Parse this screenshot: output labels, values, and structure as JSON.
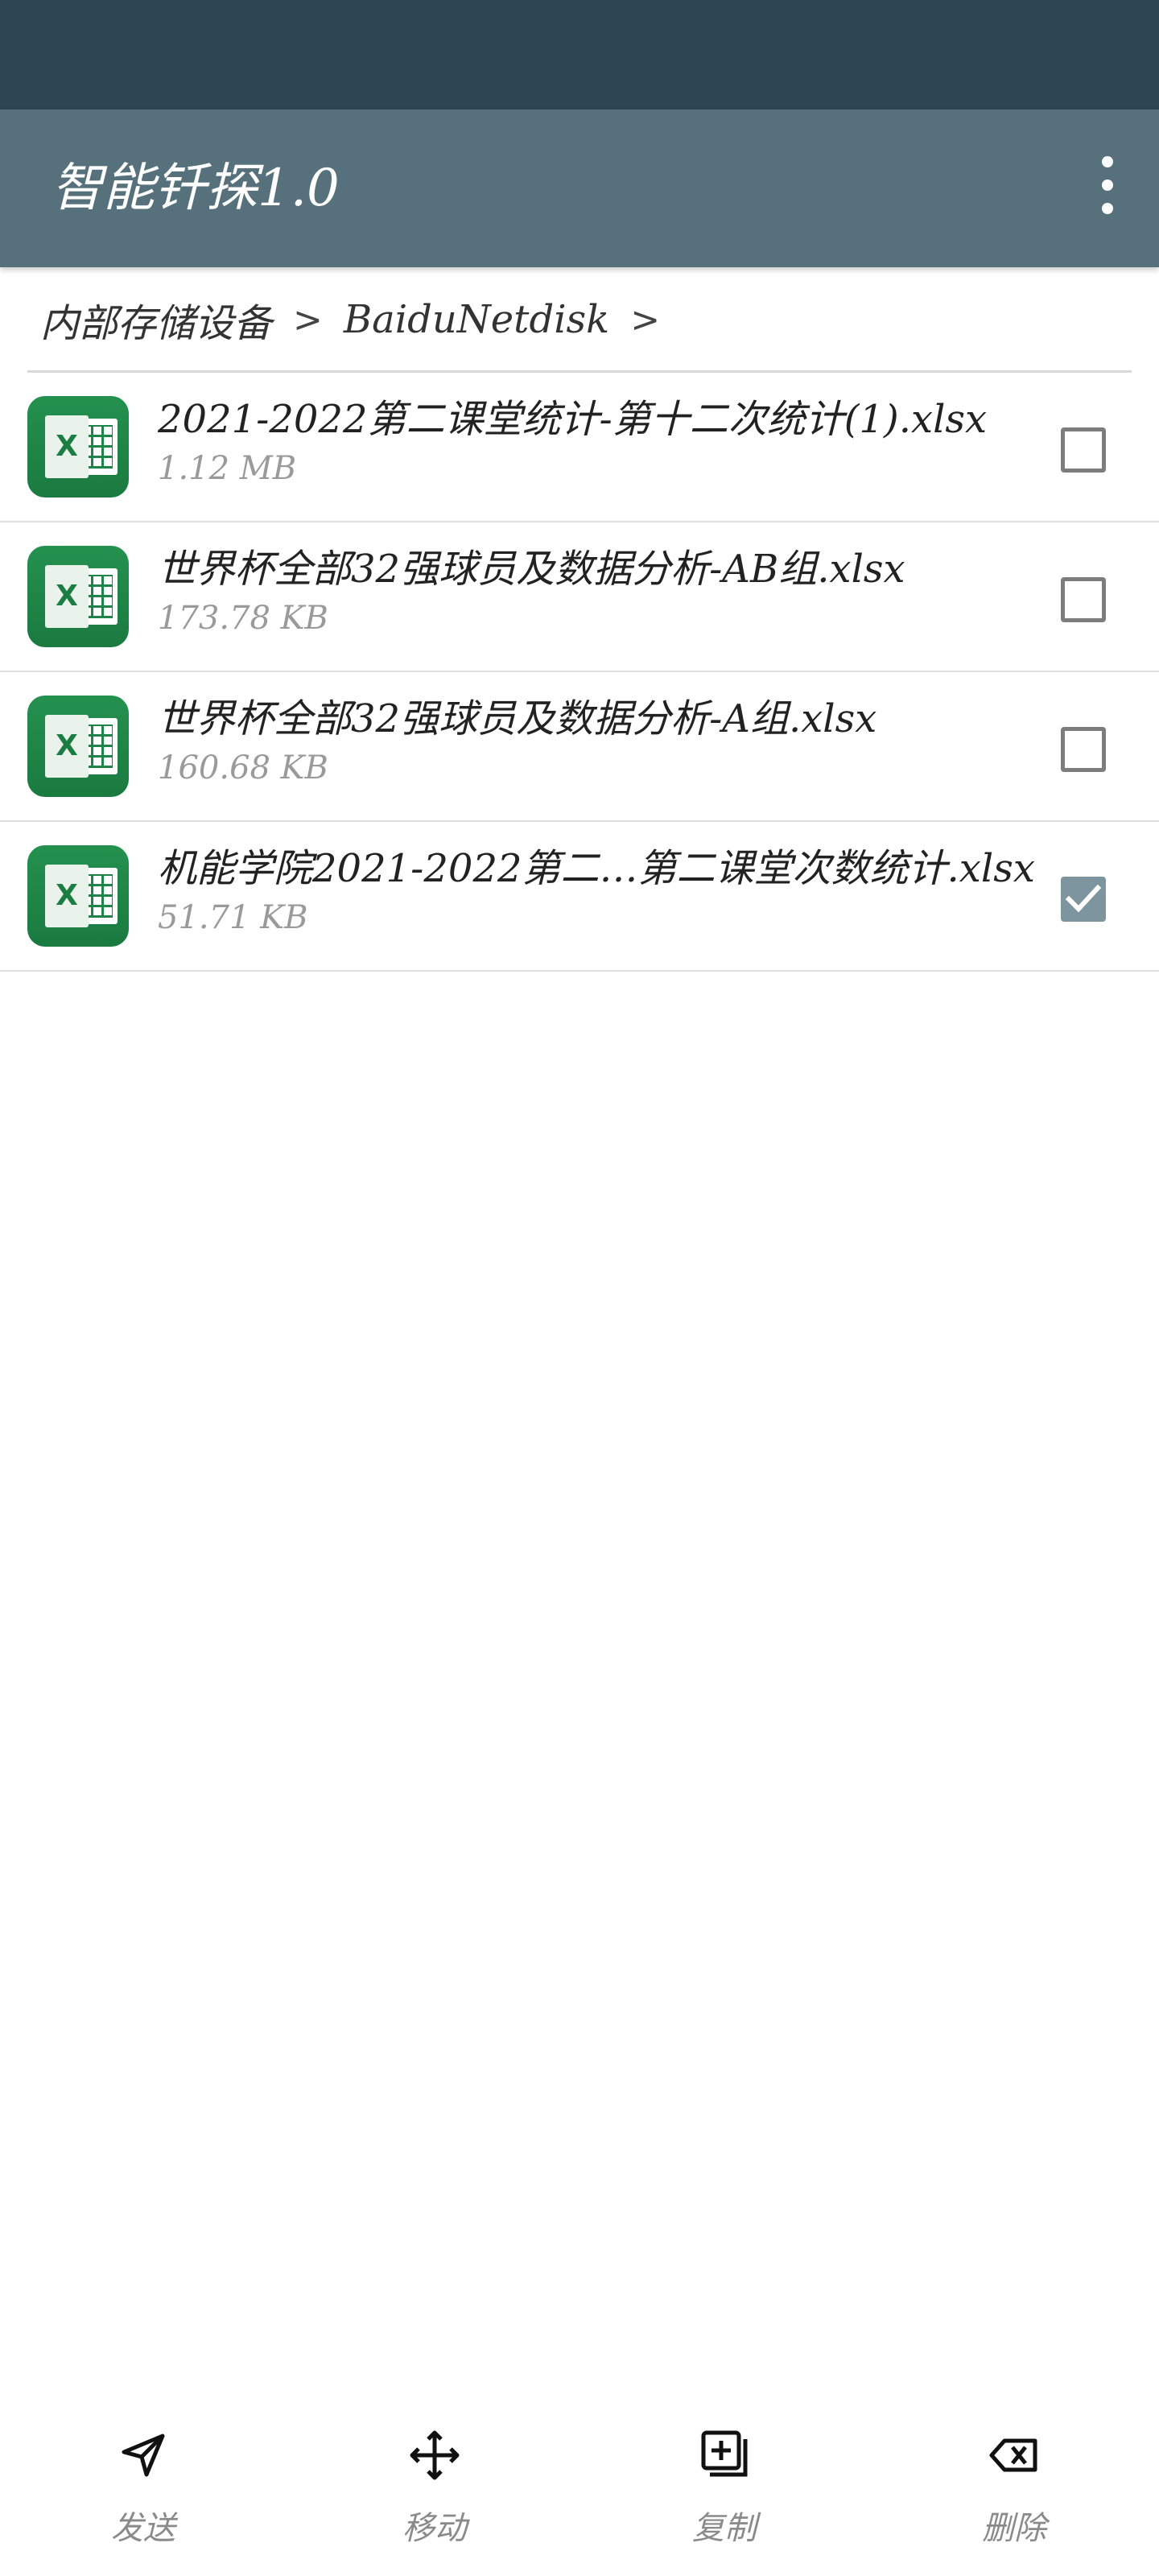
{
  "app": {
    "title": "智能钎探1.0",
    "overflow_icon": "more-vert-icon"
  },
  "breadcrumb": {
    "items": [
      "内部存储设备",
      "BaiduNetdisk"
    ],
    "separator": ">"
  },
  "files": [
    {
      "name": "2021-2022第二课堂统计-第十二次统计(1).xlsx",
      "size": "1.12 MB",
      "checked": false,
      "icon": "excel-icon"
    },
    {
      "name": "世界杯全部32强球员及数据分析-AB组.xlsx",
      "size": "173.78 KB",
      "checked": false,
      "icon": "excel-icon"
    },
    {
      "name": "世界杯全部32强球员及数据分析-A组.xlsx",
      "size": "160.68 KB",
      "checked": false,
      "icon": "excel-icon"
    },
    {
      "name": "机能学院2021-2022第二…第二课堂次数统计.xlsx",
      "size": "51.71 KB",
      "checked": true,
      "icon": "excel-icon"
    }
  ],
  "actions": [
    {
      "label": "发送",
      "icon": "send-icon"
    },
    {
      "label": "移动",
      "icon": "move-icon"
    },
    {
      "label": "复制",
      "icon": "copy-icon"
    },
    {
      "label": "删除",
      "icon": "backspace-delete-icon"
    }
  ],
  "colors": {
    "status_bar": "#2c4651",
    "app_bar": "#56717c",
    "checkbox_checked": "#7c959f",
    "excel_green": "#1e8447"
  }
}
